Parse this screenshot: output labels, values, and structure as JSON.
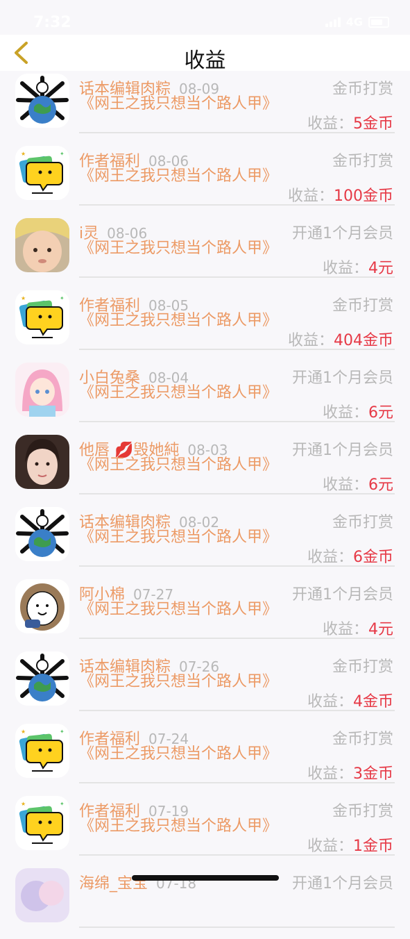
{
  "status": {
    "time": "7:32",
    "network": "4G"
  },
  "nav": {
    "title": "收益"
  },
  "rows": [
    {
      "name": "话本编辑肉粽",
      "date": "08-09",
      "kind": "金币打赏",
      "book": "《网王之我只想当个路人甲》",
      "income_label": "收益：",
      "income_value": "5金币",
      "avatar": "spiky-earth"
    },
    {
      "name": "作者福利",
      "date": "08-06",
      "kind": "金币打赏",
      "book": "《网王之我只想当个路人甲》",
      "income_label": "收益：",
      "income_value": "100金币",
      "avatar": "yellow-bubble"
    },
    {
      "name": "i灵",
      "date": "08-06",
      "kind": "开通1个月会员",
      "book": "《网王之我只想当个路人甲》",
      "income_label": "收益：",
      "income_value": "4元",
      "avatar": "baby-photo"
    },
    {
      "name": "作者福利",
      "date": "08-05",
      "kind": "金币打赏",
      "book": "《网王之我只想当个路人甲》",
      "income_label": "收益：",
      "income_value": "404金币",
      "avatar": "yellow-bubble"
    },
    {
      "name": "小白兔桑",
      "date": "08-04",
      "kind": "开通1个月会员",
      "book": "《网王之我只想当个路人甲》",
      "income_label": "收益：",
      "income_value": "6元",
      "avatar": "anime-girl"
    },
    {
      "name": "他唇 💋毁她純",
      "date": "08-03",
      "kind": "开通1个月会员",
      "book": "《网王之我只想当个路人甲》",
      "income_label": "收益：",
      "income_value": "6元",
      "avatar": "girl-photo"
    },
    {
      "name": "话本编辑肉粽",
      "date": "08-02",
      "kind": "金币打赏",
      "book": "《网王之我只想当个路人甲》",
      "income_label": "收益：",
      "income_value": "6金币",
      "avatar": "spiky-earth"
    },
    {
      "name": "阿小棉",
      "date": "07-27",
      "kind": "开通1个月会员",
      "book": "《网王之我只想当个路人甲》",
      "income_label": "收益：",
      "income_value": "4元",
      "avatar": "cartoon-face"
    },
    {
      "name": "话本编辑肉粽",
      "date": "07-26",
      "kind": "金币打赏",
      "book": "《网王之我只想当个路人甲》",
      "income_label": "收益：",
      "income_value": "4金币",
      "avatar": "spiky-earth"
    },
    {
      "name": "作者福利",
      "date": "07-24",
      "kind": "金币打赏",
      "book": "《网王之我只想当个路人甲》",
      "income_label": "收益：",
      "income_value": "3金币",
      "avatar": "yellow-bubble"
    },
    {
      "name": "作者福利",
      "date": "07-19",
      "kind": "金币打赏",
      "book": "《网王之我只想当个路人甲》",
      "income_label": "收益：",
      "income_value": "1金币",
      "avatar": "yellow-bubble"
    },
    {
      "name": "海绵_宝宝",
      "date": "07-18",
      "kind": "开通1个月会员",
      "book": "",
      "income_label": "",
      "income_value": "",
      "avatar": "pastel"
    }
  ],
  "colors": {
    "name": "#ec9a65",
    "muted": "#b8b8b8",
    "income": "#e63946",
    "back": "#c9a227"
  }
}
